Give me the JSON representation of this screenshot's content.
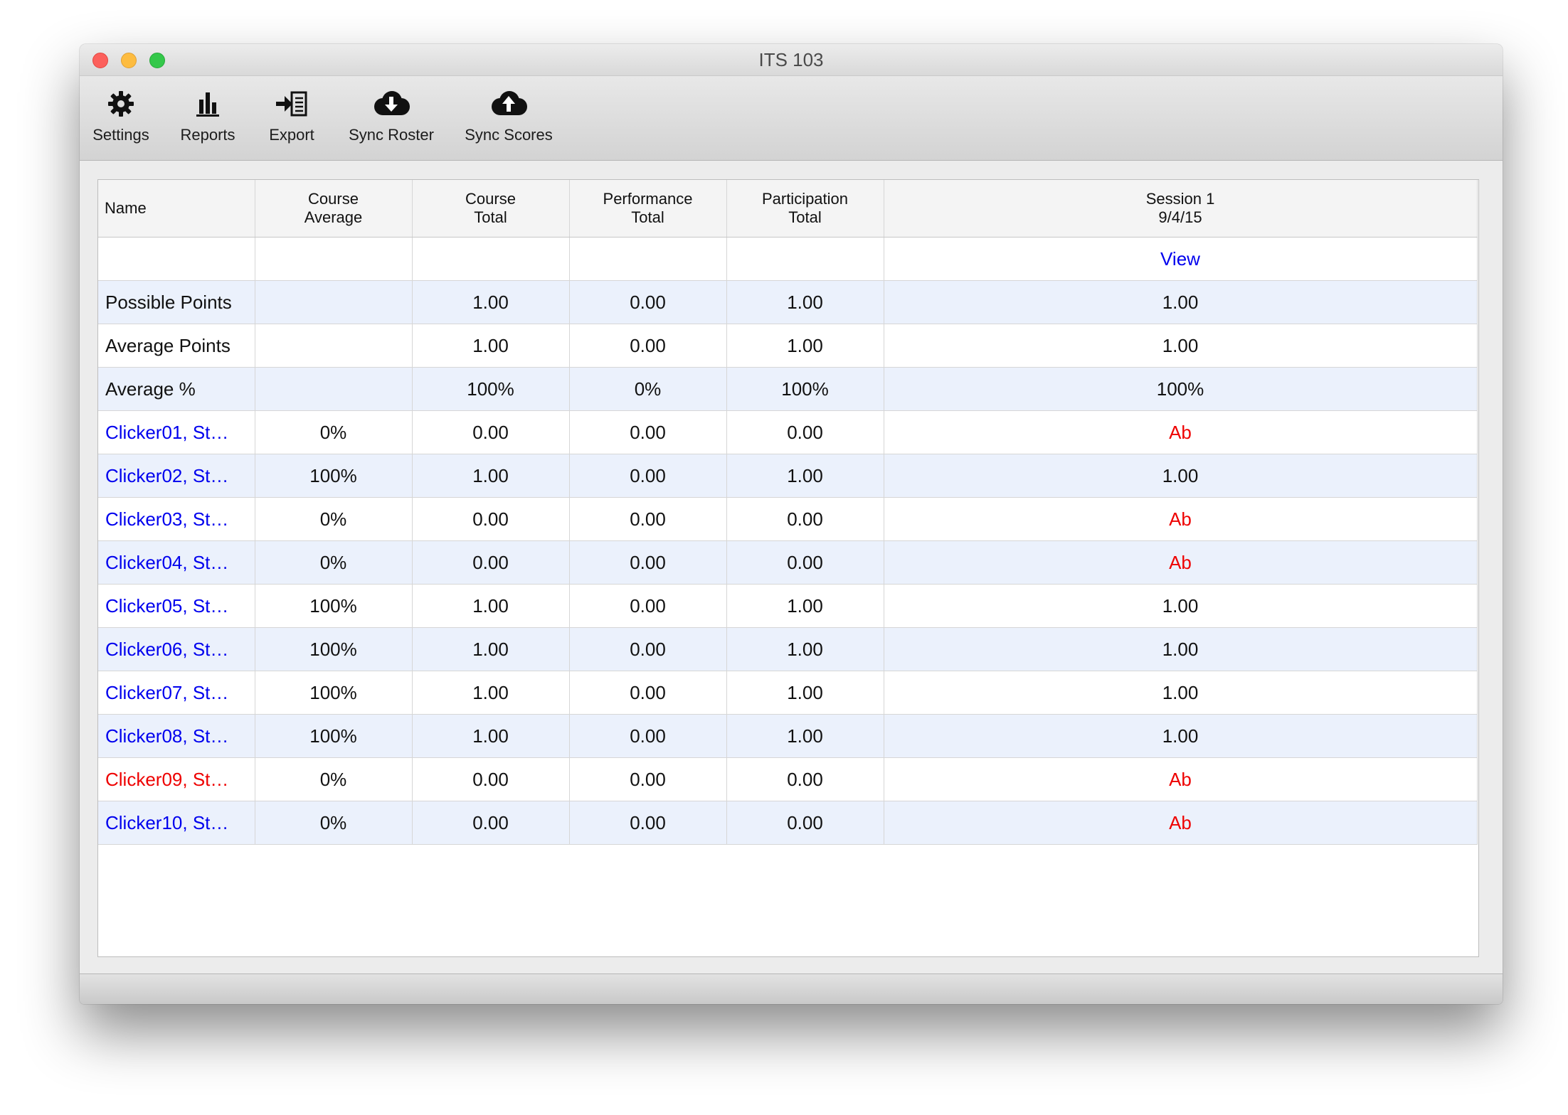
{
  "window": {
    "title": "ITS 103"
  },
  "toolbar": {
    "settings": {
      "label": "Settings",
      "icon": "gear-icon"
    },
    "reports": {
      "label": "Reports",
      "icon": "bar-chart-icon"
    },
    "export": {
      "label": "Export",
      "icon": "export-icon"
    },
    "sync_roster": {
      "label": "Sync Roster",
      "icon": "cloud-download-icon"
    },
    "sync_scores": {
      "label": "Sync Scores",
      "icon": "cloud-upload-icon"
    }
  },
  "table": {
    "headers": {
      "name": "Name",
      "course_average": [
        "Course",
        "Average"
      ],
      "course_total": [
        "Course",
        "Total"
      ],
      "performance_total": [
        "Performance",
        "Total"
      ],
      "participation_total": [
        "Participation",
        "Total"
      ],
      "session1": [
        "Session 1",
        "9/4/15"
      ]
    },
    "view_link": "View",
    "summary_rows": [
      {
        "name": "Possible Points",
        "course_average": "",
        "course_total": "1.00",
        "performance_total": "0.00",
        "participation_total": "1.00",
        "session1": "1.00"
      },
      {
        "name": "Average Points",
        "course_average": "",
        "course_total": "1.00",
        "performance_total": "0.00",
        "participation_total": "1.00",
        "session1": "1.00"
      },
      {
        "name": "Average %",
        "course_average": "",
        "course_total": "100%",
        "performance_total": "0%",
        "participation_total": "100%",
        "session1": "100%"
      }
    ],
    "students": [
      {
        "name": "Clicker01, St…",
        "course_average": "0%",
        "course_total": "0.00",
        "performance_total": "0.00",
        "participation_total": "0.00",
        "session1": "Ab"
      },
      {
        "name": "Clicker02, St…",
        "course_average": "100%",
        "course_total": "1.00",
        "performance_total": "0.00",
        "participation_total": "1.00",
        "session1": "1.00"
      },
      {
        "name": "Clicker03, St…",
        "course_average": "0%",
        "course_total": "0.00",
        "performance_total": "0.00",
        "participation_total": "0.00",
        "session1": "Ab"
      },
      {
        "name": "Clicker04, St…",
        "course_average": "0%",
        "course_total": "0.00",
        "performance_total": "0.00",
        "participation_total": "0.00",
        "session1": "Ab"
      },
      {
        "name": "Clicker05, St…",
        "course_average": "100%",
        "course_total": "1.00",
        "performance_total": "0.00",
        "participation_total": "1.00",
        "session1": "1.00"
      },
      {
        "name": "Clicker06, St…",
        "course_average": "100%",
        "course_total": "1.00",
        "performance_total": "0.00",
        "participation_total": "1.00",
        "session1": "1.00"
      },
      {
        "name": "Clicker07, St…",
        "course_average": "100%",
        "course_total": "1.00",
        "performance_total": "0.00",
        "participation_total": "1.00",
        "session1": "1.00"
      },
      {
        "name": "Clicker08, St…",
        "course_average": "100%",
        "course_total": "1.00",
        "performance_total": "0.00",
        "participation_total": "1.00",
        "session1": "1.00"
      },
      {
        "name": "Clicker09, St…",
        "course_average": "0%",
        "course_total": "0.00",
        "performance_total": "0.00",
        "participation_total": "0.00",
        "session1": "Ab"
      },
      {
        "name": "Clicker10, St…",
        "course_average": "0%",
        "course_total": "0.00",
        "performance_total": "0.00",
        "participation_total": "0.00",
        "session1": "Ab"
      }
    ]
  },
  "colors": {
    "link_blue": "#0000ee",
    "absent_red": "#ee0000",
    "row_alt": "#ebf1fc",
    "flagged_student_red": "#ee0000"
  }
}
